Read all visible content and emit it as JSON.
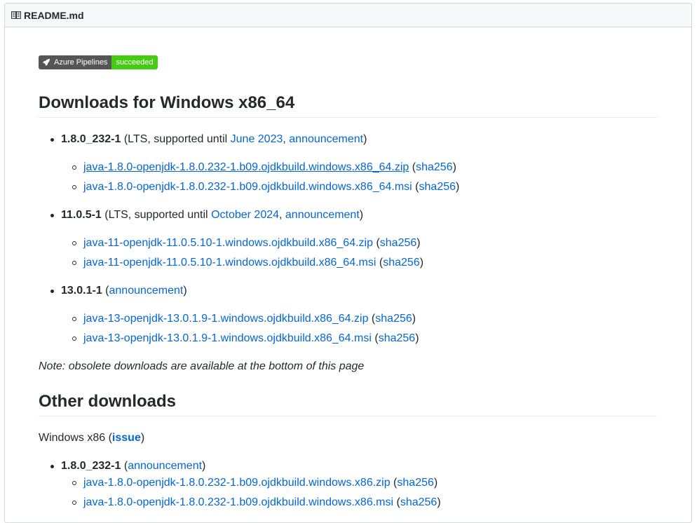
{
  "header": {
    "filename": "README.md",
    "icon": "book-icon"
  },
  "badge": {
    "left": "Azure Pipelines",
    "right": "succeeded",
    "left_color": "#555555",
    "right_color": "#44cc11"
  },
  "section1": {
    "heading": "Downloads for Windows x86_64",
    "items": [
      {
        "version": "1.8.0_232-1",
        "pre": " (LTS, supported until ",
        "until": "June 2023",
        "sep": ", ",
        "ann": "announcement",
        "post": ")",
        "files": [
          {
            "name": "java-1.8.0-openjdk-1.8.0.232-1.b09.ojdkbuild.windows.x86_64.zip",
            "sha": "sha256"
          },
          {
            "name": "java-1.8.0-openjdk-1.8.0.232-1.b09.ojdkbuild.windows.x86_64.msi",
            "sha": "sha256"
          }
        ]
      },
      {
        "version": "11.0.5-1",
        "pre": " (LTS, supported until ",
        "until": "October 2024",
        "sep": ", ",
        "ann": "announcement",
        "post": ")",
        "files": [
          {
            "name": "java-11-openjdk-11.0.5.10-1.windows.ojdkbuild.x86_64.zip",
            "sha": "sha256"
          },
          {
            "name": "java-11-openjdk-11.0.5.10-1.windows.ojdkbuild.x86_64.msi",
            "sha": "sha256"
          }
        ]
      },
      {
        "version": "13.0.1-1",
        "pre": " (",
        "ann": "announcement",
        "post": ")",
        "files": [
          {
            "name": "java-13-openjdk-13.0.1.9-1.windows.ojdkbuild.x86_64.zip",
            "sha": "sha256"
          },
          {
            "name": "java-13-openjdk-13.0.1.9-1.windows.ojdkbuild.x86_64.msi",
            "sha": "sha256"
          }
        ]
      }
    ],
    "note": "Note: obsolete downloads are available at the bottom of this page"
  },
  "section2": {
    "heading": "Other downloads",
    "sub_label": "Windows x86 (",
    "sub_link": "issue",
    "sub_post": ")",
    "items": [
      {
        "version": "1.8.0_232-1",
        "pre": " (",
        "ann": "announcement",
        "post": ")",
        "files": [
          {
            "name": "java-1.8.0-openjdk-1.8.0.232-1.b09.ojdkbuild.windows.x86.zip",
            "sha": "sha256"
          },
          {
            "name": "java-1.8.0-openjdk-1.8.0.232-1.b09.ojdkbuild.windows.x86.msi",
            "sha": "sha256"
          }
        ]
      }
    ]
  },
  "punct": {
    "open": " (",
    "close": ")"
  }
}
